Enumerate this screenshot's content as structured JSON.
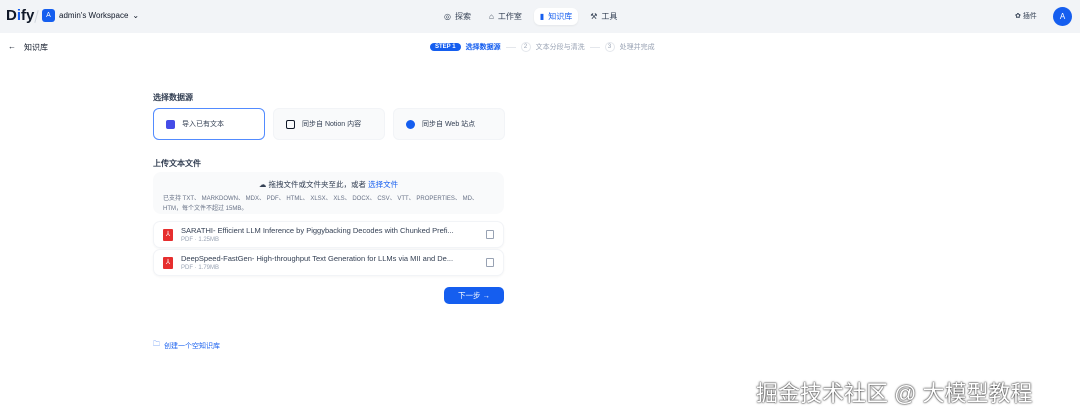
{
  "header": {
    "logo": "Dify",
    "workspace_avatar": "A",
    "workspace": "admin's Workspace",
    "nav": [
      {
        "label": "探索",
        "icon": "compass-icon"
      },
      {
        "label": "工作室",
        "icon": "robot-icon"
      },
      {
        "label": "知识库",
        "icon": "book-icon",
        "active": true
      },
      {
        "label": "工具",
        "icon": "tool-icon"
      }
    ],
    "plugins": "插件",
    "user_avatar": "A"
  },
  "back": {
    "label": "知识库"
  },
  "steps": [
    {
      "badge": "STEP 1",
      "label": "选择数据源",
      "active": true
    },
    {
      "badge": "2",
      "label": "文本分段与清洗"
    },
    {
      "badge": "3",
      "label": "处理并完成"
    }
  ],
  "datasource": {
    "title": "选择数据源",
    "options": [
      "导入已有文本",
      "同步自 Notion 内容",
      "同步自 Web 站点"
    ]
  },
  "upload": {
    "title": "上传文本文件",
    "drop_text": "拖拽文件或文件夹至此，或者",
    "select_link": "选择文件",
    "supported": "已支持 TXT、 MARKDOWN、 MDX、 PDF、 HTML、 XLSX、 XLS、 DOCX、 CSV、 VTT、 PROPERTIES、 MD、 HTM，每个文件不超过 15MB。"
  },
  "files": [
    {
      "name": "SARATHI- Efficient LLM Inference by Piggybacking Decodes with Chunked Prefi...",
      "meta": "PDF · 1.25MB"
    },
    {
      "name": "DeepSpeed-FastGen- High-throughput Text Generation for LLMs via MII and De...",
      "meta": "PDF · 1.79MB"
    }
  ],
  "next_button": "下一步 →",
  "create_empty": "创建一个空知识库",
  "watermark": "掘金技术社区 @ 大模型教程"
}
